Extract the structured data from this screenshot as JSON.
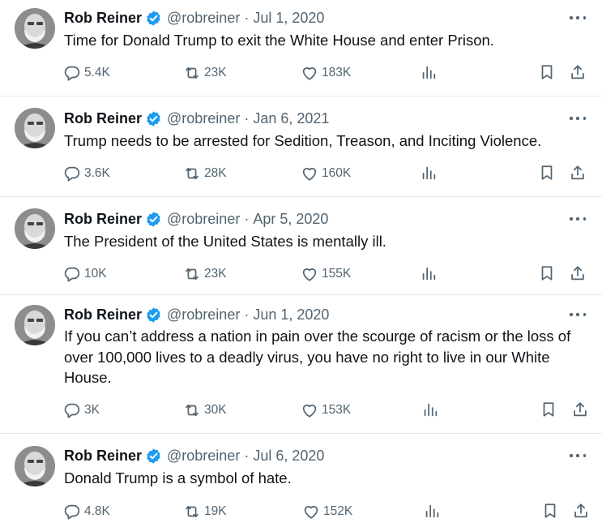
{
  "tweets": [
    {
      "name": "Rob Reiner",
      "handle": "@robreiner",
      "separator": "·",
      "date": "Jul 1, 2020",
      "text": "Time for Donald Trump to exit the White House and enter Prison.",
      "replies": "5.4K",
      "retweets": "23K",
      "likes": "183K"
    },
    {
      "name": "Rob Reiner",
      "handle": "@robreiner",
      "separator": "·",
      "date": "Jan 6, 2021",
      "text": "Trump needs to be arrested for Sedition, Treason, and Inciting Violence.",
      "replies": "3.6K",
      "retweets": "28K",
      "likes": "160K"
    },
    {
      "name": "Rob Reiner",
      "handle": "@robreiner",
      "separator": "·",
      "date": "Apr 5, 2020",
      "text": "The President of the United States is mentally ill.",
      "replies": "10K",
      "retweets": "23K",
      "likes": "155K"
    },
    {
      "name": "Rob Reiner",
      "handle": "@robreiner",
      "separator": "·",
      "date": "Jun 1, 2020",
      "text": "If you can’t address a nation in pain over the scourge of racism or the loss of over 100,000 lives to a deadly virus, you have no right to live in our White House.",
      "replies": "3K",
      "retweets": "30K",
      "likes": "153K"
    },
    {
      "name": "Rob Reiner",
      "handle": "@robreiner",
      "separator": "·",
      "date": "Jul 6, 2020",
      "text": "Donald Trump is a symbol of hate.",
      "replies": "4.8K",
      "retweets": "19K",
      "likes": "152K"
    }
  ],
  "icons": {
    "verified": "verified-badge-icon",
    "more": "more-icon",
    "reply": "reply-icon",
    "retweet": "retweet-icon",
    "like": "heart-icon",
    "views": "views-icon",
    "bookmark": "bookmark-icon",
    "share": "share-icon"
  },
  "colors": {
    "text": "#0f1419",
    "secondary": "#536471",
    "verified": "#1d9bf0",
    "divider": "#e6e8ea"
  }
}
